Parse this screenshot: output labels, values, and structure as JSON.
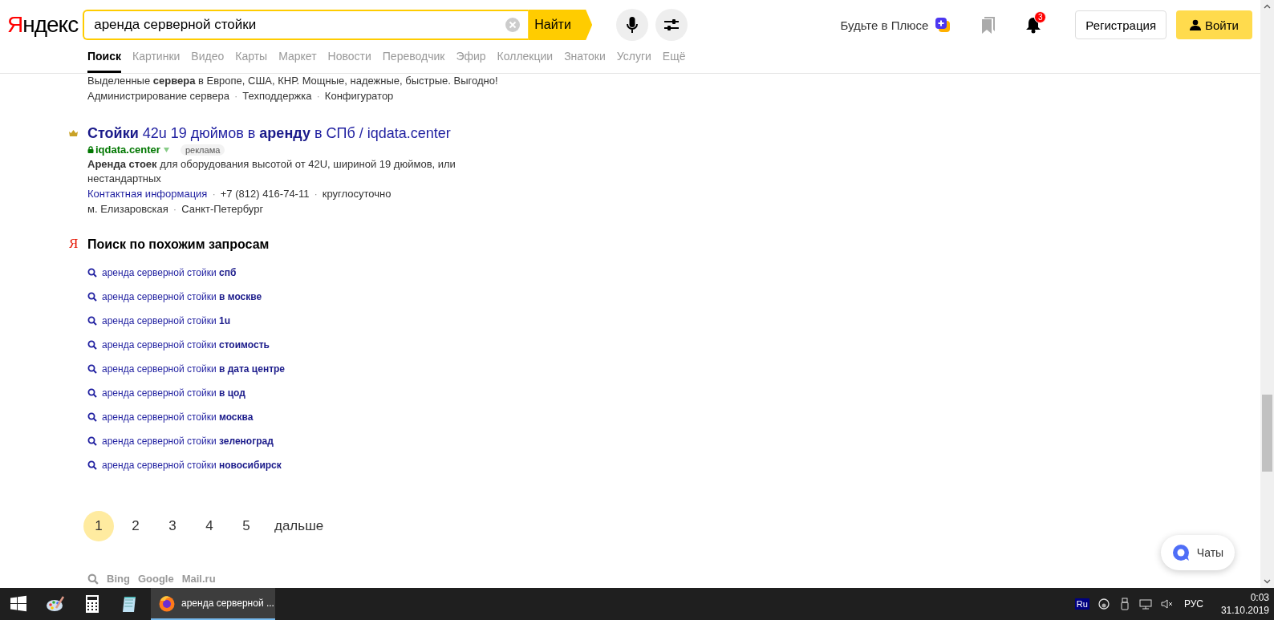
{
  "header": {
    "logo": "Яндекс",
    "search": {
      "value": "аренда серверной стойки",
      "button": "Найти"
    },
    "plus_promo": "Будьте в Плюсе",
    "notifications": "3",
    "register": "Регистрация",
    "login": "Войти"
  },
  "tabs": [
    {
      "label": "Поиск",
      "selected": true
    },
    {
      "label": "Картинки",
      "selected": false
    },
    {
      "label": "Видео",
      "selected": false
    },
    {
      "label": "Карты",
      "selected": false
    },
    {
      "label": "Маркет",
      "selected": false
    },
    {
      "label": "Новости",
      "selected": false
    },
    {
      "label": "Переводчик",
      "selected": false
    },
    {
      "label": "Эфир",
      "selected": false
    },
    {
      "label": "Коллекции",
      "selected": false
    },
    {
      "label": "Знатоки",
      "selected": false
    },
    {
      "label": "Услуги",
      "selected": false
    },
    {
      "label": "Ещё",
      "selected": false
    }
  ],
  "results": [
    {
      "kind": "tail",
      "text": "Выделенные **сервера** в Европе, США, КНР. Мощные, надежные, быстрые. Выгодно!",
      "sitelinks": [
        {
          "kind": "link",
          "text": "Администрирование сервера"
        },
        {
          "kind": "sep",
          "text": "·"
        },
        {
          "kind": "link",
          "text": "Техподдержка"
        },
        {
          "kind": "sep",
          "text": "·"
        },
        {
          "kind": "link",
          "text": "Конфигуратор"
        }
      ]
    },
    {
      "kind": "ad",
      "title": "**Стойки** 42u 19 дюймов в **аренду** в СПб / iqdata.center",
      "domain": "iqdata.center",
      "badge": "реклама",
      "text": "**Аренда стоек** для оборудования высотой от 42U, шириной 19 дюймов, или нестандартных",
      "contacts": [
        {
          "kind": "link",
          "text": "Контактная информация"
        },
        {
          "kind": "sep",
          "text": "·"
        },
        {
          "kind": "text",
          "text": "+7 (812) 416-74-11"
        },
        {
          "kind": "sep",
          "text": "·"
        },
        {
          "kind": "text",
          "text": "круглосуточно"
        }
      ],
      "address": [
        {
          "kind": "text",
          "text": "м. Елизаровская"
        },
        {
          "kind": "sep",
          "text": "·"
        },
        {
          "kind": "text",
          "text": "Санкт-Петербург"
        }
      ]
    }
  ],
  "related": {
    "icon": "Я",
    "title": "Поиск по похожим запросам",
    "items": [
      "аренда серверной стойки **спб**",
      "аренда серверной стойки **в москве**",
      "аренда серверной стойки **1u**",
      "аренда серверной стойки **стоимость**",
      "аренда серверной стойки **в дата центре**",
      "аренда серверной стойки **в цод**",
      "аренда серверной стойки **москва**",
      "аренда серверной стойки **зеленоград**",
      "аренда серверной стойки **новосибирск**"
    ]
  },
  "pagination": {
    "pages": [
      {
        "label": "1",
        "selected": true
      },
      {
        "label": "2",
        "selected": false
      },
      {
        "label": "3",
        "selected": false
      },
      {
        "label": "4",
        "selected": false
      },
      {
        "label": "5",
        "selected": false
      }
    ],
    "next": "дальше"
  },
  "other_engines": [
    "Bing",
    "Google",
    "Mail.ru"
  ],
  "chat": "Чаты",
  "taskbar": {
    "pinned": [
      {
        "kind": "start"
      },
      {
        "kind": "paint"
      },
      {
        "kind": "calculator"
      },
      {
        "kind": "notepad"
      }
    ],
    "tasks": [
      {
        "label": "аренда серверной ...",
        "selected": true
      }
    ],
    "tray": {
      "lang_badge": "Ru",
      "lang": "РУС",
      "time": "0:03",
      "date": "31.10.2019"
    }
  }
}
